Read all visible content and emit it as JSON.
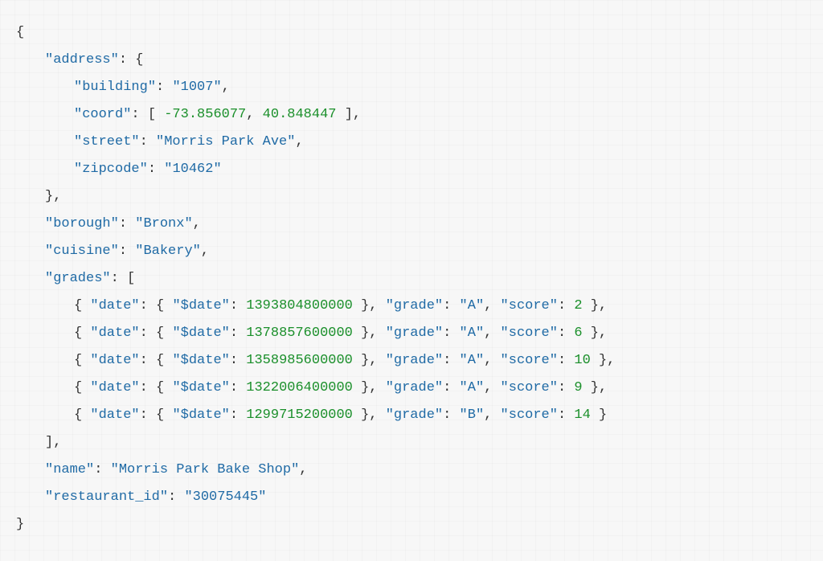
{
  "doc": {
    "address": {
      "building": "1007",
      "coord": [
        -73.856077,
        40.848447
      ],
      "street": "Morris Park Ave",
      "zipcode": "10462"
    },
    "borough": "Bronx",
    "cuisine": "Bakery",
    "grades": [
      {
        "date": {
          "$date": 1393804800000
        },
        "grade": "A",
        "score": 2
      },
      {
        "date": {
          "$date": 1378857600000
        },
        "grade": "A",
        "score": 6
      },
      {
        "date": {
          "$date": 1358985600000
        },
        "grade": "A",
        "score": 10
      },
      {
        "date": {
          "$date": 1322006400000
        },
        "grade": "A",
        "score": 9
      },
      {
        "date": {
          "$date": 1299715200000
        },
        "grade": "B",
        "score": 14
      }
    ],
    "name": "Morris Park Bake Shop",
    "restaurant_id": "30075445"
  },
  "keys": {
    "address": "address",
    "building": "building",
    "coord": "coord",
    "street": "street",
    "zipcode": "zipcode",
    "borough": "borough",
    "cuisine": "cuisine",
    "grades": "grades",
    "date": "date",
    "edate": "$date",
    "grade": "grade",
    "score": "score",
    "name": "name",
    "restaurant_id": "restaurant_id"
  }
}
